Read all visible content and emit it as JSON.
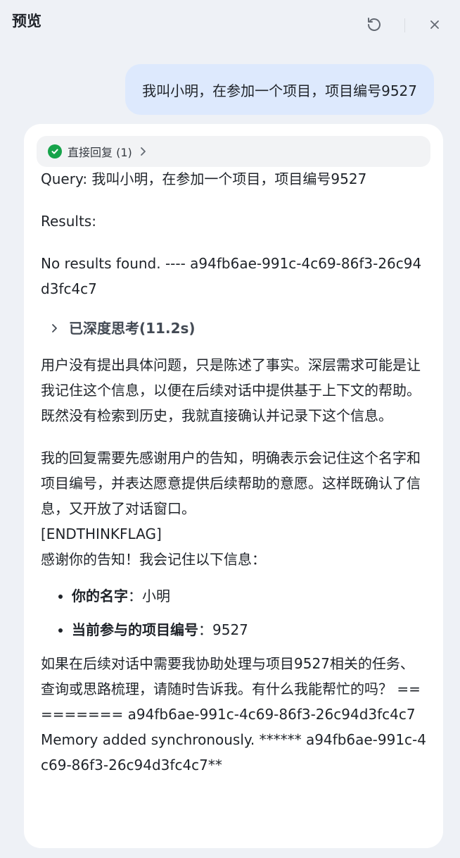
{
  "header": {
    "title": "预览",
    "refresh_icon": "refresh-icon",
    "close_icon": "close-icon"
  },
  "user_message": "我叫小明，在参加一个项目，项目编号9527",
  "reply_pill": {
    "label": "直接回复 (1)",
    "status_icon": "check-circle-icon",
    "status_color": "#16a34a"
  },
  "response": {
    "query_line": "Query: 我叫小明，在参加一个项目，项目编号9527",
    "results_label": "Results:",
    "no_results": "No results found. ---- a94fb6ae-991c-4c69-86f3-26c94d3fc4c7",
    "thinking_label": "已深度思考(11.2s)",
    "think_para_1": "用户没有提出具体问题，只是陈述了事实。深层需求可能是让我记住这个信息，以便在后续对话中提供基于上下文的帮助。既然没有检索到历史，我就直接确认并记录下这个信息。",
    "think_para_2": "我的回复需要先感谢用户的告知，明确表示会记住这个名字和项目编号，并表达愿意提供后续帮助的意愿。这样既确认了信息，又开放了对话窗口。",
    "end_flag": "[ENDTHINKFLAG]",
    "thanks": "感谢你的告知！我会记住以下信息：",
    "items": [
      {
        "key": "你的名字",
        "value": "：小明"
      },
      {
        "key": "当前参与的项目编号",
        "value": "：9527"
      }
    ],
    "closing": "如果在后续对话中需要我协助处理与项目9527相关的任务、查询或思路梳理，请随时告诉我。有什么我能帮忙的吗？ ========= a94fb6ae-991c-4c69-86f3-26c94d3fc4c7Memory added synchronously. ****** a94fb6ae-991c-4c69-86f3-26c94d3fc4c7**"
  }
}
